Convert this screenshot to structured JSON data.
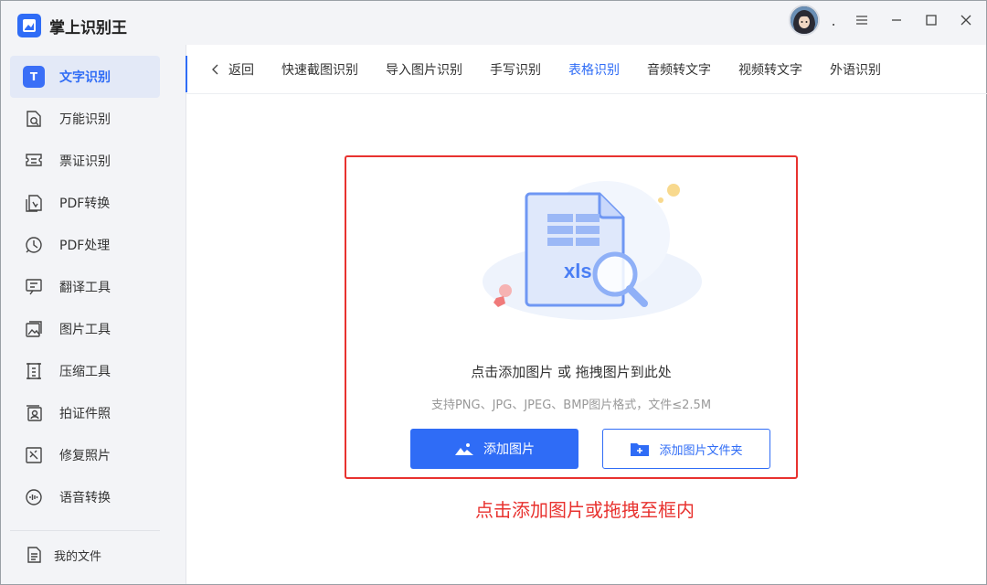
{
  "app": {
    "title": "掌上识别王"
  },
  "sidebar": {
    "items": [
      {
        "label": "文字识别",
        "icon": "text-t-icon",
        "active": true
      },
      {
        "label": "万能识别",
        "icon": "scan-search-icon"
      },
      {
        "label": "票证识别",
        "icon": "ticket-icon"
      },
      {
        "label": "PDF转换",
        "icon": "pdf-convert-icon"
      },
      {
        "label": "PDF处理",
        "icon": "pdf-process-icon"
      },
      {
        "label": "翻译工具",
        "icon": "translate-icon"
      },
      {
        "label": "图片工具",
        "icon": "image-tool-icon"
      },
      {
        "label": "压缩工具",
        "icon": "compress-icon"
      },
      {
        "label": "拍证件照",
        "icon": "id-photo-icon"
      },
      {
        "label": "修复照片",
        "icon": "repair-photo-icon"
      },
      {
        "label": "语音转换",
        "icon": "voice-convert-icon"
      }
    ],
    "my_files": "我的文件"
  },
  "titlebar": {
    "dot": "."
  },
  "tabs": {
    "back": "返回",
    "items": [
      {
        "label": "快速截图识别"
      },
      {
        "label": "导入图片识别"
      },
      {
        "label": "手写识别"
      },
      {
        "label": "表格识别",
        "active": true
      },
      {
        "label": "音频转文字"
      },
      {
        "label": "视频转文字"
      },
      {
        "label": "外语识别"
      }
    ]
  },
  "dropzone": {
    "file_tag": "xls",
    "title": "点击添加图片 或 拖拽图片到此处",
    "hint": "支持PNG、JPG、JPEG、BMP图片格式，文件≤2.5M",
    "add_image": "添加图片",
    "add_folder": "添加图片文件夹"
  },
  "annotation": "点击添加图片或拖拽至框内",
  "colors": {
    "accent": "#2f6cf6",
    "highlight": "#e8322f"
  }
}
